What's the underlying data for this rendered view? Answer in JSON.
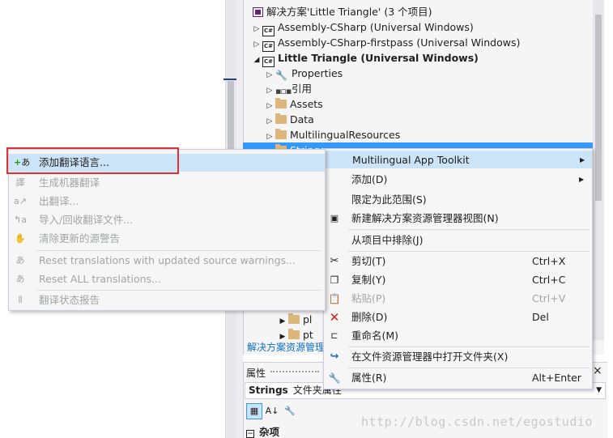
{
  "solution_explorer": {
    "rows": [
      {
        "label": "解决方案'Little Triangle' (3 个项目)",
        "icon": "solution-icon"
      },
      {
        "label": "Assembly-CSharp (Universal Windows)",
        "icon": "csharp-project-icon"
      },
      {
        "label": "Assembly-CSharp-firstpass (Universal Windows)",
        "icon": "csharp-project-icon"
      },
      {
        "label": "Little Triangle (Universal Windows)",
        "icon": "csharp-project-icon"
      },
      {
        "label": "Properties",
        "icon": "wrench-icon"
      },
      {
        "label": "引用",
        "icon": "references-icon"
      },
      {
        "label": "Assets",
        "icon": "folder-icon"
      },
      {
        "label": "Data",
        "icon": "folder-icon"
      },
      {
        "label": "MultilingualResources",
        "icon": "folder-icon"
      },
      {
        "label": "Strings",
        "icon": "folder-icon"
      },
      {
        "label": "pl",
        "icon": "folder-icon"
      },
      {
        "label": "pt",
        "icon": "folder-icon"
      }
    ],
    "tab_label": "解决方案资源管理"
  },
  "properties": {
    "header": "属性",
    "close": "×",
    "object_name": "Strings",
    "object_type": "文件夹属性",
    "category": "杂项"
  },
  "context_menu": {
    "items": [
      {
        "label": "Multilingual App Toolkit",
        "shortcut": "",
        "submenu": true,
        "icon": ""
      },
      {
        "label": "添加(D)",
        "shortcut": "",
        "submenu": true,
        "icon": ""
      },
      {
        "label": "限定为此范围(S)",
        "shortcut": "",
        "submenu": false,
        "icon": ""
      },
      {
        "label": "新建解决方案资源管理器视图(N)",
        "shortcut": "",
        "submenu": false,
        "icon": "new-view-icon"
      },
      {
        "label": "从项目中排除(J)",
        "shortcut": "",
        "submenu": false,
        "icon": ""
      },
      {
        "label": "剪切(T)",
        "shortcut": "Ctrl+X",
        "submenu": false,
        "icon": "scissors-icon"
      },
      {
        "label": "复制(Y)",
        "shortcut": "Ctrl+C",
        "submenu": false,
        "icon": "copy-icon"
      },
      {
        "label": "粘贴(P)",
        "shortcut": "Ctrl+V",
        "submenu": false,
        "icon": "paste-icon"
      },
      {
        "label": "删除(D)",
        "shortcut": "Del",
        "submenu": false,
        "icon": "delete-icon"
      },
      {
        "label": "重命名(M)",
        "shortcut": "",
        "submenu": false,
        "icon": "rename-icon"
      },
      {
        "label": "在文件资源管理器中打开文件夹(X)",
        "shortcut": "",
        "submenu": false,
        "icon": "open-folder-arrow-icon"
      },
      {
        "label": "属性(R)",
        "shortcut": "Alt+Enter",
        "submenu": false,
        "icon": "wrench-icon"
      }
    ],
    "submenu_arrow": "▶"
  },
  "submenu": {
    "items": [
      {
        "label": "添加翻译语言...",
        "enabled": true
      },
      {
        "label": "生成机器翻译",
        "enabled": false
      },
      {
        "label": "出翻译...",
        "enabled": false
      },
      {
        "label": "导入/回收翻译文件...",
        "enabled": false
      },
      {
        "label": "清除更新的源警告",
        "enabled": false
      },
      {
        "label": "Reset translations with updated source warnings...",
        "enabled": false
      },
      {
        "label": "Reset ALL translations...",
        "enabled": false
      },
      {
        "label": "翻译状态报告",
        "enabled": false
      }
    ]
  },
  "watermark": "http://blog.csdn.net/egostudio",
  "colors": {
    "selection": "#3399ff",
    "menu_hover": "#cce4f7",
    "highlight_box": "#e03131",
    "delete_red": "#c8201a"
  }
}
